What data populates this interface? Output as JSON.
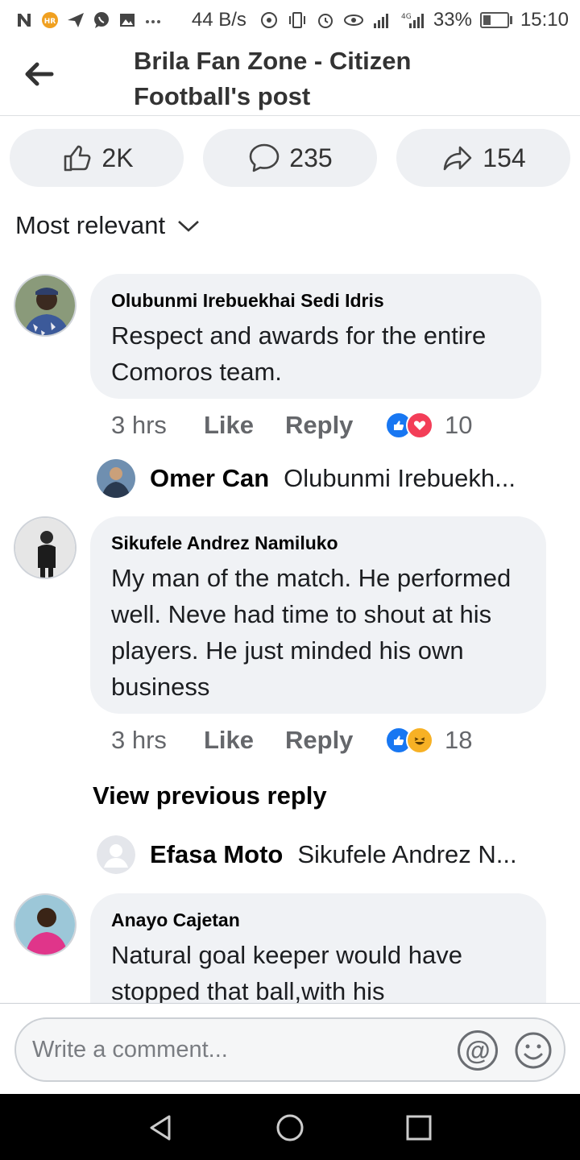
{
  "status_bar": {
    "left_icons": [
      "n-icon",
      "badge-icon",
      "send-icon",
      "whatsapp-icon",
      "image-icon",
      "more-icon"
    ],
    "speed": "44 B/s",
    "battery": "33%",
    "battery_level": 0.33,
    "time": "15:10"
  },
  "header": {
    "title": "Brila Fan Zone - Citizen Football's post"
  },
  "actions": {
    "likes": "2K",
    "comments": "235",
    "shares": "154"
  },
  "sort": {
    "label": "Most relevant"
  },
  "comments": [
    {
      "name": "Olubunmi Irebuekhai Sedi Idris",
      "text": "Respect and awards for the entire Comoros team.",
      "time": "3 hrs",
      "like_label": "Like",
      "reply_label": "Reply",
      "reactions": [
        "like",
        "love"
      ],
      "reaction_count": "10",
      "reply": {
        "name": "Omer Can",
        "snippet": "Olubunmi Irebuekh..."
      }
    },
    {
      "name": "Sikufele Andrez Namiluko",
      "text": "My man of the match.  He performed well.  Neve had time to shout at his players.  He just minded  his own business",
      "time": "3 hrs",
      "like_label": "Like",
      "reply_label": "Reply",
      "reactions": [
        "like",
        "haha"
      ],
      "reaction_count": "18",
      "view_previous": "View previous reply",
      "reply": {
        "name": "Efasa Moto",
        "snippet": "Sikufele Andrez N..."
      }
    },
    {
      "name": "Anayo Cajetan",
      "text": "Natural goal keeper would have stopped that ball,with his"
    }
  ],
  "composer": {
    "placeholder": "Write a comment..."
  },
  "colors": {
    "like_blue": "#1877f2",
    "love_red": "#f33e58",
    "haha_yellow": "#f7b125",
    "bubble_gray": "#f0f2f5"
  }
}
